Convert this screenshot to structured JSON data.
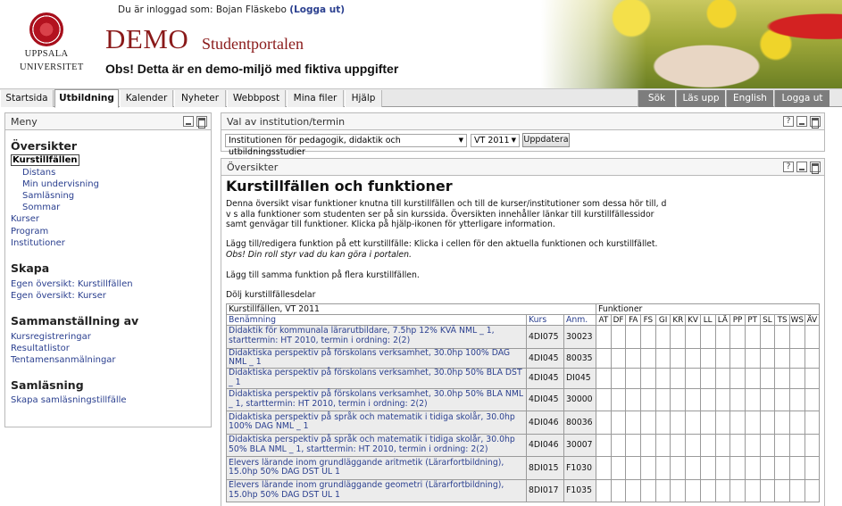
{
  "header": {
    "logged_in_prefix": "Du är inloggad som: Bojan Fläskebo",
    "logout_label": "(Logga ut)",
    "logo_line1": "UPPSALA",
    "logo_line2": "UNIVERSITET",
    "demo": "DEMO",
    "portal": "Studentportalen",
    "warning": "Obs! Detta är en demo-miljö med fiktiva uppgifter"
  },
  "nav": {
    "tabs": [
      "Startsida",
      "Utbildning",
      "Kalender",
      "Nyheter",
      "Webbpost",
      "Mina filer",
      "Hjälp"
    ],
    "right_tabs": [
      "Sök",
      "Läs upp",
      "English",
      "Logga ut"
    ]
  },
  "menu": {
    "title": "Meny",
    "oversikter_heading": "Översikter",
    "oversikter_items": [
      "Kurstillfällen",
      "Distans",
      "Min undervisning",
      "Samläsning",
      "Sommar",
      "Kurser",
      "Program",
      "Institutioner"
    ],
    "skapa_heading": "Skapa",
    "skapa_items": [
      "Egen översikt: Kurstillfällen",
      "Egen översikt: Kurser"
    ],
    "samman_heading": "Sammanställning av",
    "samman_items": [
      "Kursregistreringar",
      "Resultatlistor",
      "Tentamensanmälningar"
    ],
    "samlasning_heading": "Samläsning",
    "samlasning_items": [
      "Skapa samläsningstillfälle"
    ]
  },
  "selector": {
    "title": "Val av institution/termin",
    "institution": "Institutionen för pedagogik, didaktik och utbildningsstudier",
    "term": "VT 2011",
    "update_label": "Uppdatera"
  },
  "overview": {
    "title": "Översikter",
    "heading": "Kurstillfällen och funktioner",
    "para1": "Denna översikt visar funktioner knutna till kurstillfällen och till de kurser/institutioner som dessa hör till, d v s alla funktioner som studenten ser på sin kurssida. Översikten innehåller länkar till kurstillfällessidor samt genvägar till funktioner. Klicka på hjälp-ikonen för ytterligare information.",
    "para2_lead": "Lägg till/redigera funktion på ett kurstillfälle: Klicka i cellen för den aktuella funktionen och kurstillfället.",
    "para2_italic": "Obs! Din roll styr vad du kan göra i portalen.",
    "link_add": "Lägg till samma funktion på flera kurstillfällen.",
    "link_hide": "Dölj kurstillfällesdelar"
  },
  "table": {
    "period": "Kurstillfällen, VT 2011",
    "functions_label": "Funktioner",
    "col_name": "Benämning",
    "col_course": "Kurs",
    "col_anm": "Anm.",
    "functions": [
      "AT",
      "DF",
      "FA",
      "FS",
      "GI",
      "KR",
      "KV",
      "LL",
      "LÄ",
      "PP",
      "PT",
      "SL",
      "TS",
      "WS",
      "ÄV"
    ],
    "rows": [
      {
        "name": "Didaktik för kommunala lärarutbildare, 7.5hp 12% KVÄ NML _ 1, starttermin: HT 2010, termin i ordning: 2(2)",
        "course": "4DI075",
        "anm": "30023"
      },
      {
        "name": "Didaktiska perspektiv på förskolans verksamhet, 30.0hp 100% DAG NML _ 1",
        "course": "4DI045",
        "anm": "80035"
      },
      {
        "name": "Didaktiska perspektiv på förskolans verksamhet, 30.0hp 50% BLA DST _ 1",
        "course": "4DI045",
        "anm": "DI045"
      },
      {
        "name": "Didaktiska perspektiv på förskolans verksamhet, 30.0hp 50% BLA NML _ 1, starttermin: HT 2010, termin i ordning: 2(2)",
        "course": "4DI045",
        "anm": "30000"
      },
      {
        "name": "Didaktiska perspektiv på språk och matematik i tidiga skolår, 30.0hp 100% DAG NML _ 1",
        "course": "4DI046",
        "anm": "80036"
      },
      {
        "name": "Didaktiska perspektiv på språk och matematik i tidiga skolår, 30.0hp 50% BLA NML _ 1, starttermin: HT 2010, termin i ordning: 2(2)",
        "course": "4DI046",
        "anm": "30007"
      },
      {
        "name": "Elevers lärande inom grundläggande aritmetik (Lärarfortbildning), 15.0hp 50% DAG DST UL 1",
        "course": "8DI015",
        "anm": "F1030"
      },
      {
        "name": "Elevers lärande inom grundläggande geometri (Lärarfortbildning), 15.0hp 50% DAG DST UL 1",
        "course": "8DI017",
        "anm": "F1035"
      }
    ]
  }
}
